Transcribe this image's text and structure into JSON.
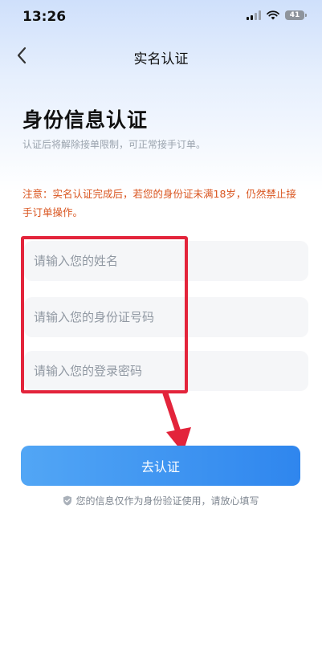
{
  "status_bar": {
    "time": "13:26",
    "battery": "41"
  },
  "nav": {
    "title": "实名认证"
  },
  "page": {
    "heading": "身份信息认证",
    "subheading": "认证后将解除接单限制，可正常接手订单。",
    "notice": "注意：实名认证完成后，若您的身份证未满18岁，仍然禁止接手订单操作。"
  },
  "form": {
    "name_placeholder": "请输入您的姓名",
    "id_placeholder": "请输入您的身份证号码",
    "password_placeholder": "请输入您的登录密码",
    "submit_label": "去认证",
    "privacy_text": "您的信息仅作为身份验证使用，请放心填写"
  },
  "colors": {
    "accent": "#3a8ff0",
    "notice": "#d9541e",
    "highlight": "#e3243b"
  }
}
